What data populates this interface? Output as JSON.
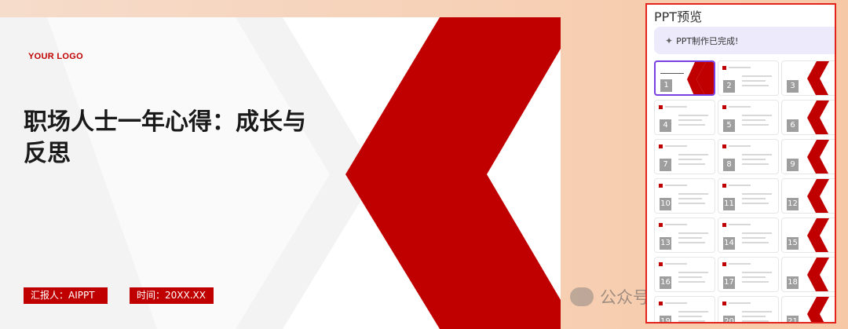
{
  "slide": {
    "logo": "YOUR LOGO",
    "title": "职场人士一年心得：成长与反思",
    "reporter": "汇报人：AIPPT",
    "time": "时间：20XX.XX"
  },
  "panel": {
    "title": "PPT预览",
    "status": "PPT制作已完成!",
    "status_icon": "sparkle-icon",
    "thumbnails": [
      "1",
      "2",
      "3",
      "4",
      "5",
      "6",
      "7",
      "8",
      "9",
      "10",
      "11",
      "12",
      "13",
      "14",
      "15",
      "16",
      "17",
      "18",
      "19",
      "20",
      "21"
    ],
    "selected": "1"
  },
  "watermark": {
    "text": "公众号 · 未来AI工具",
    "icon": "wechat-icon"
  },
  "colors": {
    "accent": "#c00000",
    "panel_border": "#e2241c",
    "selected_border": "#7a3fe0",
    "status_bg": "#eceafb"
  }
}
